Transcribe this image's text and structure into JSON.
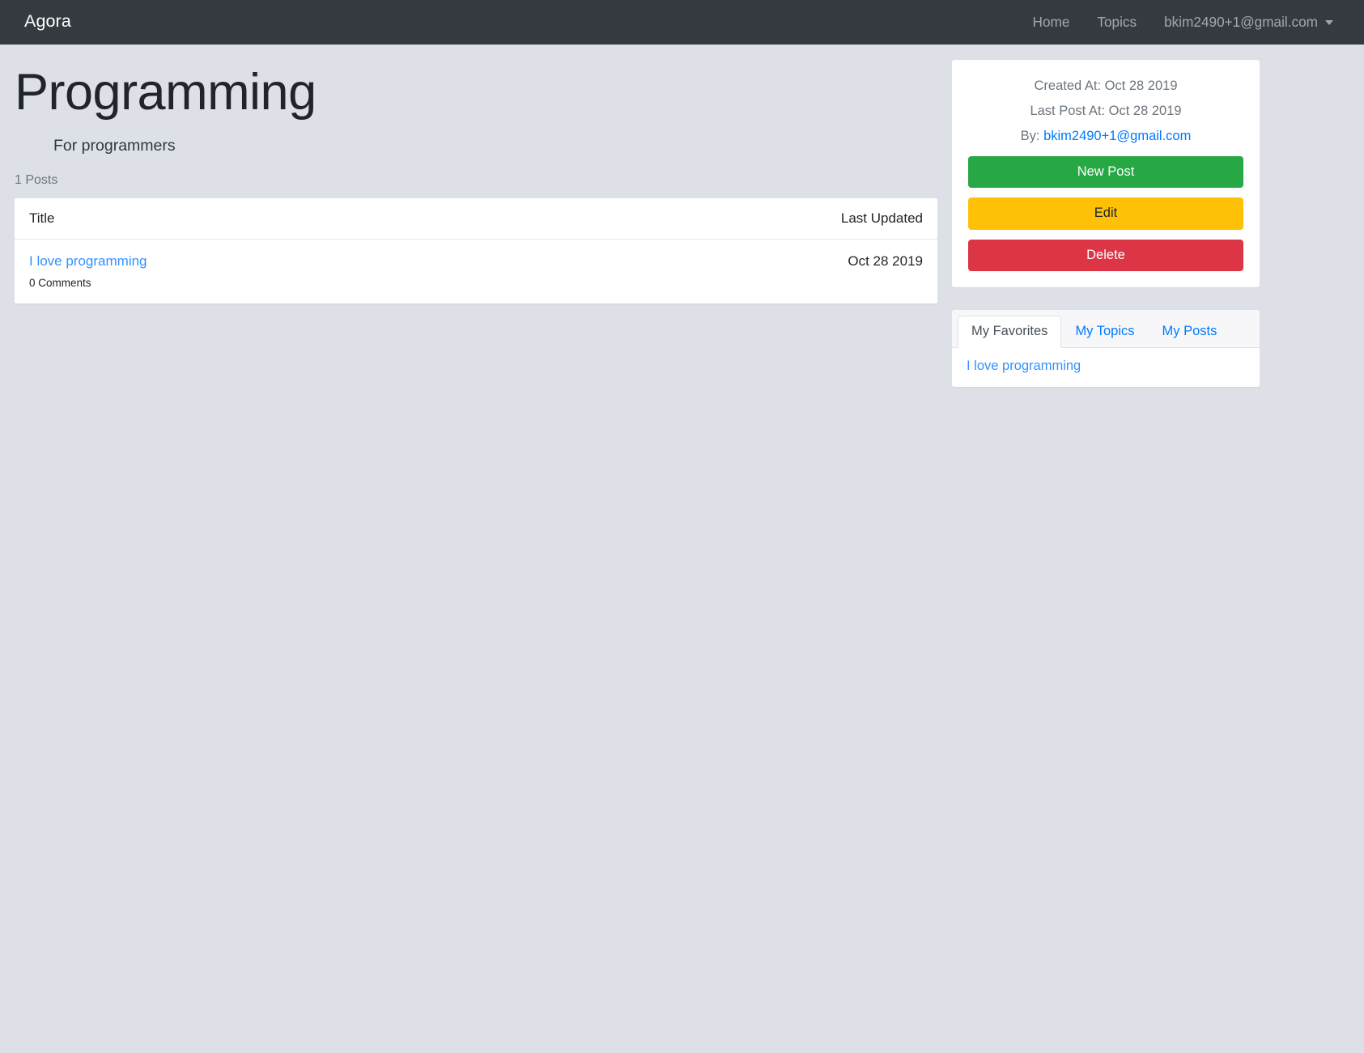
{
  "navbar": {
    "brand": "Agora",
    "links": [
      {
        "label": "Home",
        "name": "nav-link-home"
      },
      {
        "label": "Topics",
        "name": "nav-link-topics"
      }
    ],
    "user": "bkim2490+1@gmail.com"
  },
  "page": {
    "title": "Programming",
    "subtitle": "For programmers",
    "posts_count": "1 Posts"
  },
  "posts_table": {
    "columns": {
      "title": "Title",
      "last_updated": "Last Updated"
    },
    "rows": [
      {
        "title": "I love programming",
        "comments": "0 Comments",
        "last_updated": "Oct 28 2019"
      }
    ]
  },
  "info_card": {
    "created_at": "Created At: Oct 28 2019",
    "last_post_at": "Last Post At: Oct 28 2019",
    "by_label": "By:",
    "by_user": "bkim2490+1@gmail.com",
    "buttons": {
      "new_post": "New Post",
      "edit": "Edit",
      "delete": "Delete"
    }
  },
  "tabs_card": {
    "tabs": [
      {
        "label": "My Favorites",
        "active": true
      },
      {
        "label": "My Topics",
        "active": false
      },
      {
        "label": "My Posts",
        "active": false
      }
    ],
    "favorites": [
      "I love programming"
    ]
  },
  "colors": {
    "navbar_bg": "#343a40",
    "page_bg": "#dde1e7",
    "link": "#3391ff",
    "success": "#28a745",
    "warning": "#ffc107",
    "danger": "#dc3545"
  }
}
